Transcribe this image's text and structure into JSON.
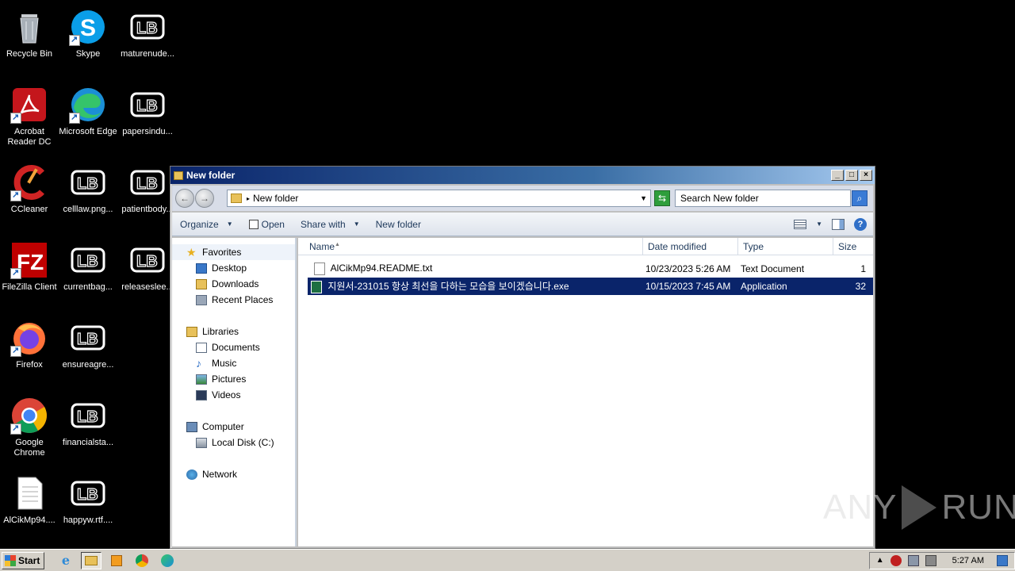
{
  "desktop": {
    "icons": [
      {
        "label": "Recycle Bin",
        "icon": "recycle-bin-icon"
      },
      {
        "label": "Skype",
        "icon": "skype-icon"
      },
      {
        "label": "maturenude...",
        "icon": "document-icon"
      },
      {
        "label": "Acrobat Reader DC",
        "icon": "acrobat-icon"
      },
      {
        "label": "Microsoft Edge",
        "icon": "edge-icon"
      },
      {
        "label": "papersindu...",
        "icon": "document-icon"
      },
      {
        "label": "CCleaner",
        "icon": "ccleaner-icon"
      },
      {
        "label": "celllaw.png...",
        "icon": "document-icon"
      },
      {
        "label": "patientbody...",
        "icon": "document-icon"
      },
      {
        "label": "FileZilla Client",
        "icon": "filezilla-icon"
      },
      {
        "label": "currentbag...",
        "icon": "document-icon"
      },
      {
        "label": "releaseslee...",
        "icon": "document-icon"
      },
      {
        "label": "Firefox",
        "icon": "firefox-icon"
      },
      {
        "label": "ensureagre...",
        "icon": "document-icon"
      },
      {
        "label": "Google Chrome",
        "icon": "chrome-icon"
      },
      {
        "label": "financialsta...",
        "icon": "document-icon"
      },
      {
        "label": "AlCikMp94....",
        "icon": "text-file-icon"
      },
      {
        "label": "happyw.rtf....",
        "icon": "document-icon"
      }
    ]
  },
  "window": {
    "title": "New folder",
    "address": "New folder",
    "search_placeholder": "Search New folder",
    "toolbar": {
      "organize": "Organize",
      "open": "Open",
      "share_with": "Share with",
      "new_folder": "New folder"
    },
    "nav": {
      "favorites": "Favorites",
      "desktop": "Desktop",
      "downloads": "Downloads",
      "recent_places": "Recent Places",
      "libraries": "Libraries",
      "documents": "Documents",
      "music": "Music",
      "pictures": "Pictures",
      "videos": "Videos",
      "computer": "Computer",
      "local_disk": "Local Disk (C:)",
      "network": "Network"
    },
    "columns": {
      "name": "Name",
      "date_modified": "Date modified",
      "type": "Type",
      "size": "Size"
    },
    "files": [
      {
        "name": "AlCikMp94.README.txt",
        "date": "10/23/2023 5:26 AM",
        "type": "Text Document",
        "size": "1"
      },
      {
        "name": "지원서-231015 항상 최선을 다하는 모습을 보이겠습니다.exe",
        "date": "10/15/2023 7:45 AM",
        "type": "Application",
        "size": "32"
      }
    ]
  },
  "taskbar": {
    "start_label": "Start",
    "clock": "5:27 AM"
  },
  "watermark": {
    "left": "ANY",
    "right": "RUN"
  },
  "colors": {
    "selection": "#0a246a",
    "titlebar": "#0a246a"
  }
}
